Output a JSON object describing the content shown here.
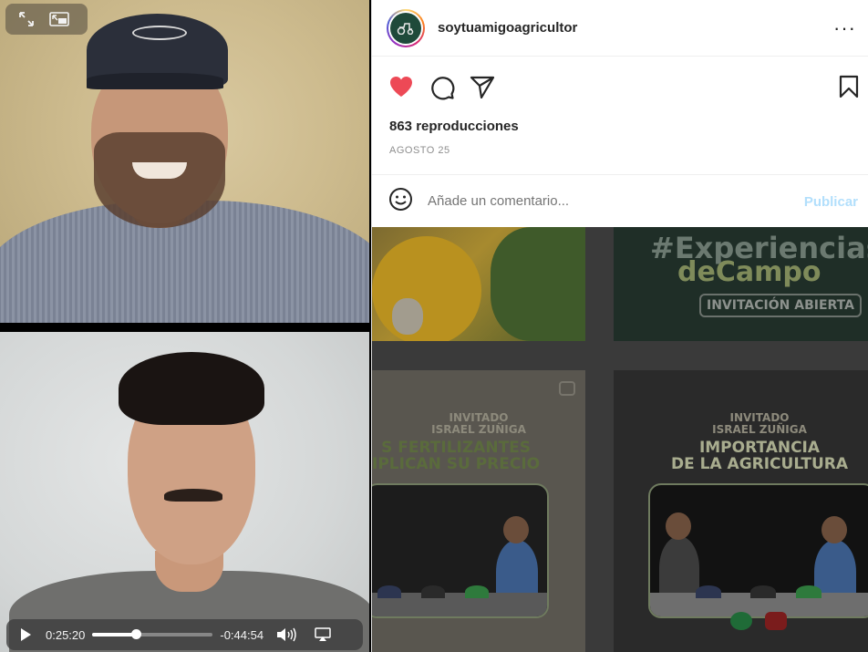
{
  "video": {
    "pip_buttons": [
      "expand-icon",
      "pip-exit-icon"
    ],
    "current_time": "0:25:20",
    "remaining_time": "-0:44:54",
    "progress": 0.36
  },
  "post": {
    "username": "soytuamigoagricultor",
    "views": "863 reproducciones",
    "date": "AGOSTO 25",
    "comment_placeholder": "Añade un comentario...",
    "publish_label": "Publicar",
    "liked": true,
    "colors": {
      "like": "#ed4956",
      "publish_disabled": "#b2dffc",
      "text": "#262626",
      "muted": "#8e8e8e"
    }
  },
  "grid": {
    "tile2": {
      "line1": "#Experiencias",
      "line2": "deCampo",
      "badge": "INVITACIÓN ABIERTA"
    },
    "tile3": {
      "guest_line1": "INVITADO",
      "guest_line2": "ISRAEL ZUÑIGA",
      "title_line1": "S FERTILIZANTES",
      "title_line2": "IPLICAN SU PRECIO"
    },
    "tile4": {
      "guest_line1": "INVITADO",
      "guest_line2": "ISRAEL ZUÑIGA",
      "title_line1": "IMPORTANCIA",
      "title_line2": "DE LA AGRICULTURA"
    }
  }
}
